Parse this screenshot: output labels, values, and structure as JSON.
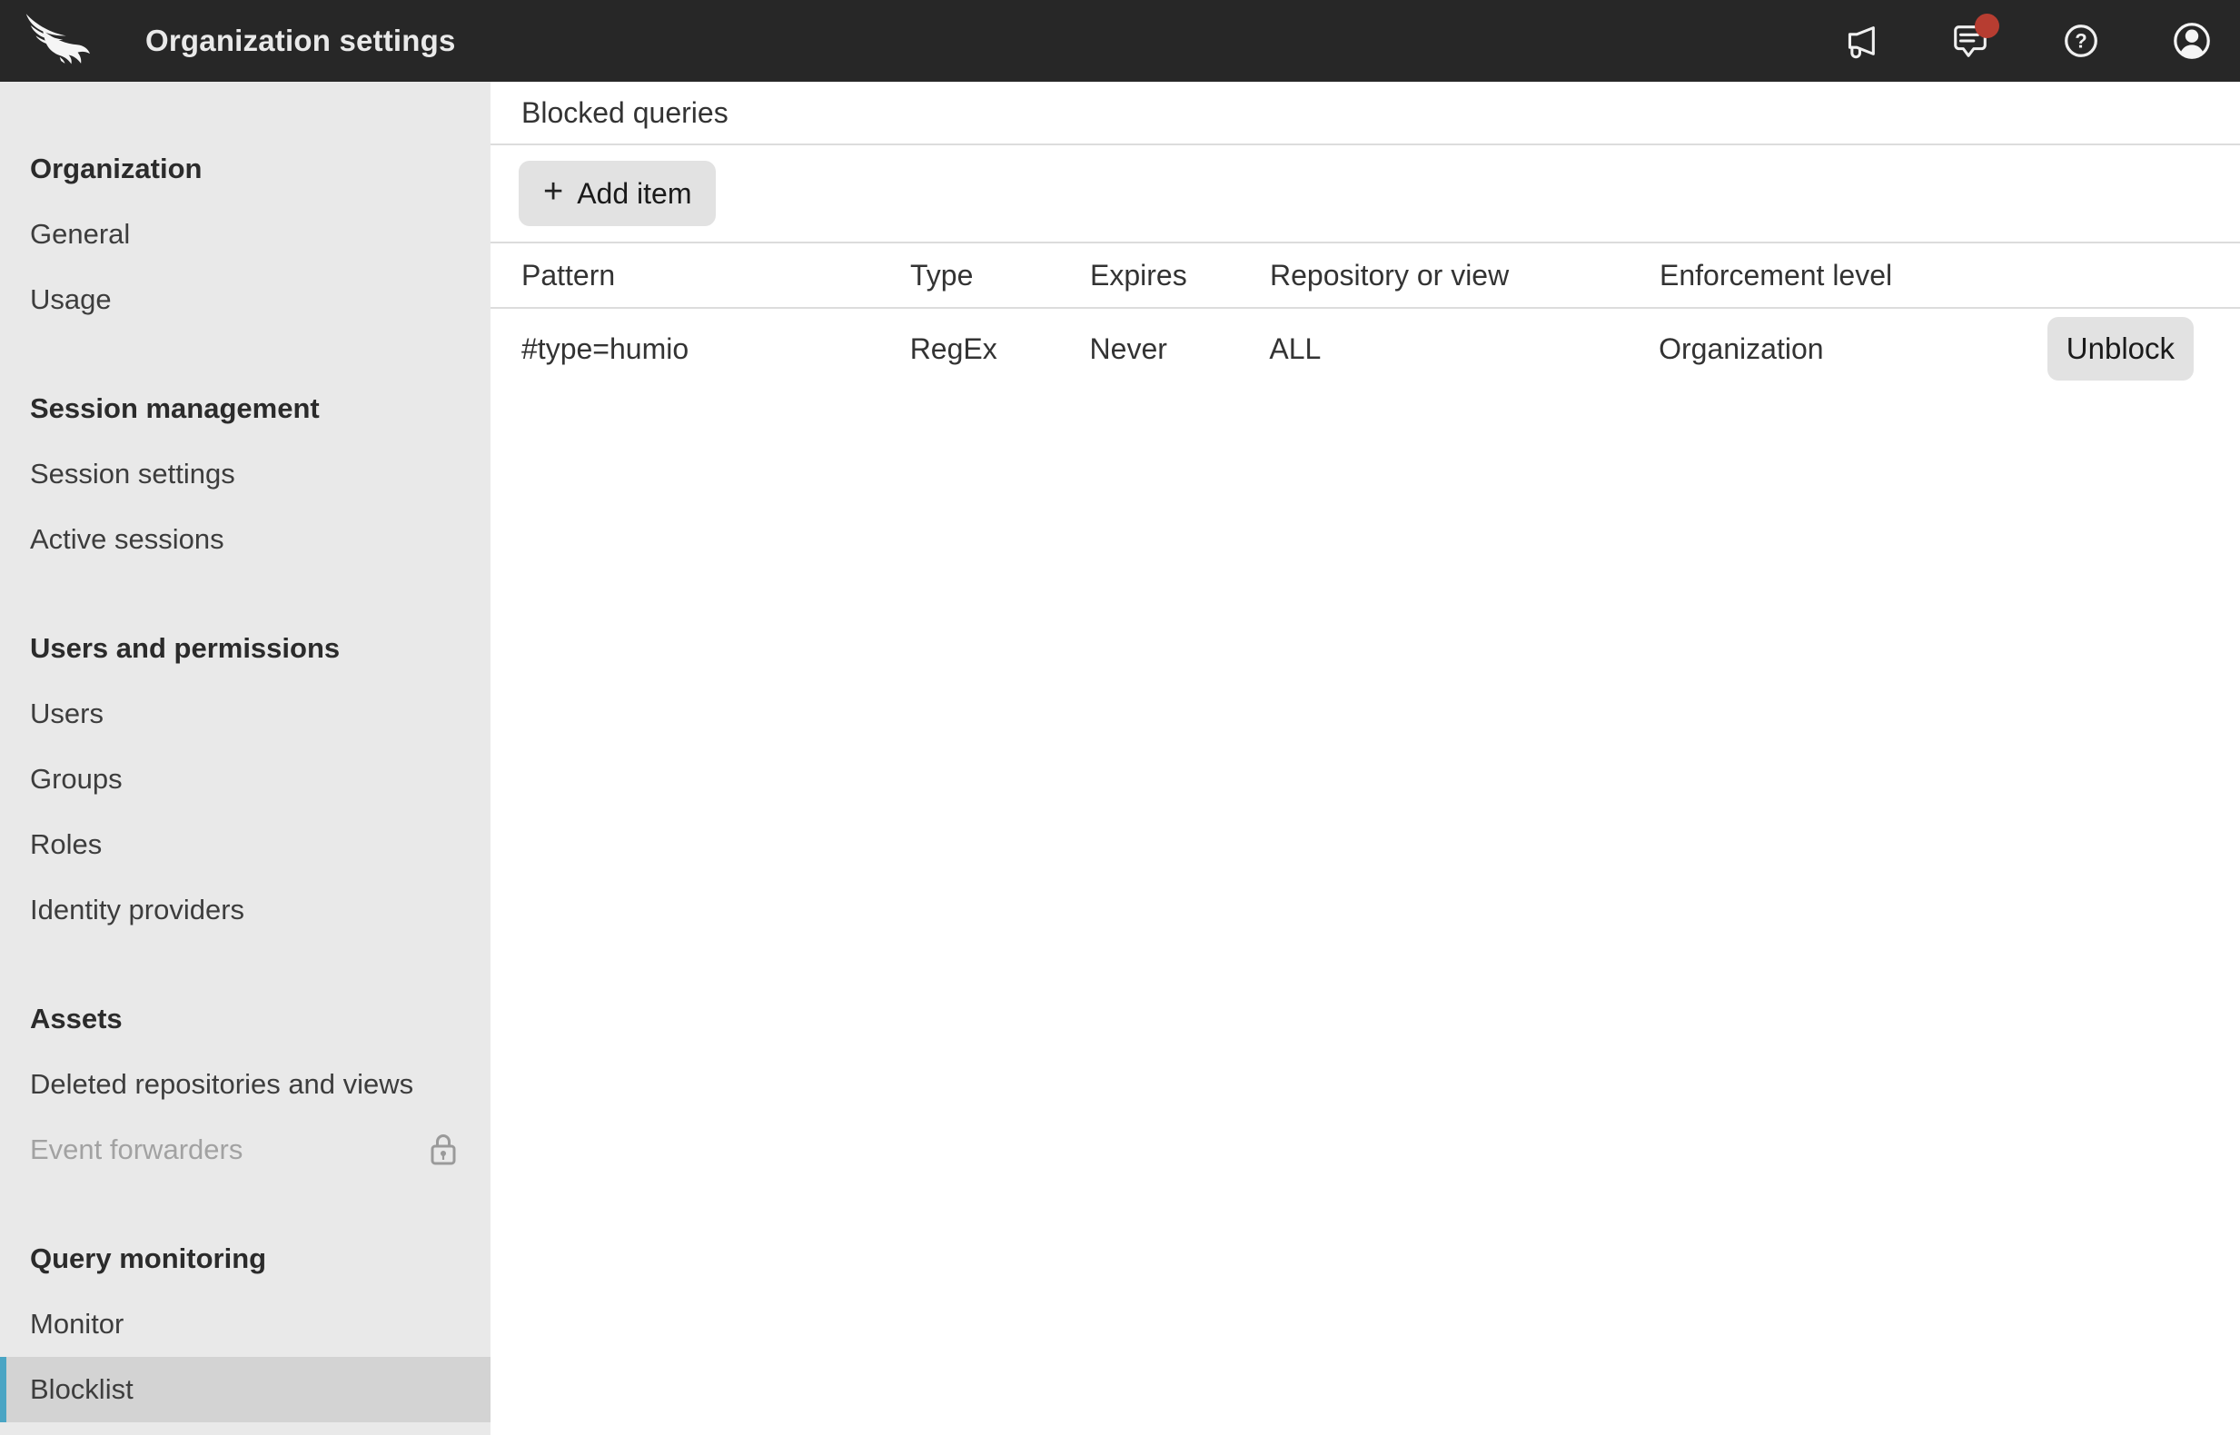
{
  "topbar": {
    "title": "Organization settings",
    "icons": {
      "announcements": "megaphone-icon",
      "messages": "chat-bubble-icon",
      "messages_has_unread": true,
      "help": "question-circle-icon",
      "account": "user-avatar-icon"
    }
  },
  "sidebar": {
    "sections": [
      {
        "label": "Organization",
        "items": [
          {
            "label": "General"
          },
          {
            "label": "Usage"
          }
        ]
      },
      {
        "label": "Session management",
        "items": [
          {
            "label": "Session settings"
          },
          {
            "label": "Active sessions"
          }
        ]
      },
      {
        "label": "Users and permissions",
        "items": [
          {
            "label": "Users"
          },
          {
            "label": "Groups"
          },
          {
            "label": "Roles"
          },
          {
            "label": "Identity providers"
          }
        ]
      },
      {
        "label": "Assets",
        "items": [
          {
            "label": "Deleted repositories and views"
          },
          {
            "label": "Event forwarders",
            "disabled": true,
            "locked": true
          }
        ]
      },
      {
        "label": "Query monitoring",
        "items": [
          {
            "label": "Monitor"
          },
          {
            "label": "Blocklist",
            "selected": true
          }
        ]
      }
    ]
  },
  "main": {
    "heading": "Blocked queries",
    "add_button": {
      "plus": "+",
      "label": "Add item"
    },
    "table": {
      "columns": {
        "pattern": "Pattern",
        "type": "Type",
        "expires": "Expires",
        "repository": "Repository or view",
        "enforcement": "Enforcement level"
      },
      "rows": [
        {
          "pattern": "#type=humio",
          "type": "RegEx",
          "expires": "Never",
          "repository": "ALL",
          "enforcement": "Organization",
          "action": "Unblock"
        }
      ]
    }
  },
  "colors": {
    "topbar_bg": "#272727",
    "sidebar_bg": "#e9e9e9",
    "selected_item_bg": "#d3d3d3",
    "accent_teal": "#4aa5c4",
    "unread_dot_red": "#b73d31",
    "button_gray": "#e2e2e2",
    "divider": "#dcdcdc"
  }
}
